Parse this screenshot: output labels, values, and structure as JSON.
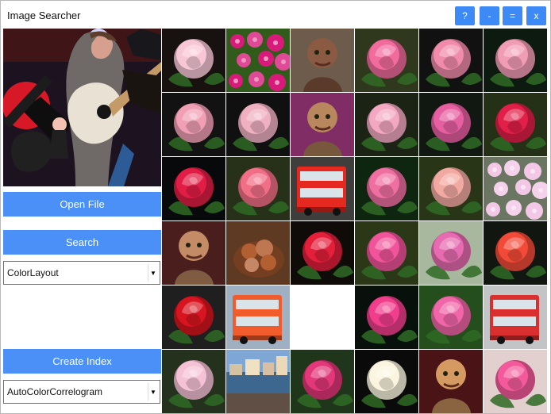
{
  "window": {
    "title": "Image Searcher"
  },
  "window_controls": [
    {
      "name": "help-button",
      "label": "?"
    },
    {
      "name": "minimize-button",
      "label": "-"
    },
    {
      "name": "maximize-button",
      "label": "="
    },
    {
      "name": "close-button",
      "label": "x"
    }
  ],
  "left_panel": {
    "open_file_label": "Open File",
    "search_label": "Search",
    "search_feature": "ColorLayout",
    "create_index_label": "Create Index",
    "index_feature": "AutoColorCorrelogram"
  },
  "results": [
    {
      "kind": "rose",
      "color": "#f7c7d6",
      "bg": "#17120f"
    },
    {
      "kind": "flowers",
      "color": "#d81b7a",
      "bg": "#315b1a"
    },
    {
      "kind": "portrait",
      "color": "#8a5a42",
      "bg": "#6d5b4b"
    },
    {
      "kind": "rose",
      "color": "#f16b9c",
      "bg": "#2f381d"
    },
    {
      "kind": "rose",
      "color": "#f08bab",
      "bg": "#111111"
    },
    {
      "kind": "rose",
      "color": "#f19cb5",
      "bg": "#0d1a10"
    },
    {
      "kind": "rose",
      "color": "#f09fb4",
      "bg": "#121212"
    },
    {
      "kind": "rose",
      "color": "#efb0c2",
      "bg": "#101010"
    },
    {
      "kind": "portrait",
      "color": "#b9875d",
      "bg": "#7f2d64"
    },
    {
      "kind": "rose",
      "color": "#f3a8c1",
      "bg": "#1b2414"
    },
    {
      "kind": "rose",
      "color": "#e65fa1",
      "bg": "#111711"
    },
    {
      "kind": "rose",
      "color": "#e21f48",
      "bg": "#243117"
    },
    {
      "kind": "rose",
      "color": "#e11d45",
      "bg": "#08090a"
    },
    {
      "kind": "rose",
      "color": "#f16f86",
      "bg": "#273019"
    },
    {
      "kind": "bus",
      "color": "#e52820",
      "bg": "#3e3f3c"
    },
    {
      "kind": "rose",
      "color": "#f06fa1",
      "bg": "#0e2510"
    },
    {
      "kind": "rose",
      "color": "#f2a9a2",
      "bg": "#283517"
    },
    {
      "kind": "flowers",
      "color": "#f3c7e6",
      "bg": "#6a7661"
    },
    {
      "kind": "portrait",
      "color": "#c48c66",
      "bg": "#4a1e1c"
    },
    {
      "kind": "food",
      "color": "#b25f31",
      "bg": "#5e3a22"
    },
    {
      "kind": "rose",
      "color": "#e31f3a",
      "bg": "#0e0b08"
    },
    {
      "kind": "rose",
      "color": "#f1549b",
      "bg": "#2b3818"
    },
    {
      "kind": "rose",
      "color": "#e66bb0",
      "bg": "#a7b89e"
    },
    {
      "kind": "rose",
      "color": "#f34a38",
      "bg": "#111611"
    },
    {
      "kind": "rose",
      "color": "#d7141f",
      "bg": "#1f1f1f"
    },
    {
      "kind": "bus",
      "color": "#f05c2c",
      "bg": "#9eb0c2"
    },
    {
      "kind": "blank",
      "color": "#ffffff",
      "bg": "#ffffff"
    },
    {
      "kind": "rose",
      "color": "#f03d8c",
      "bg": "#07100a"
    },
    {
      "kind": "rose",
      "color": "#f066a8",
      "bg": "#244e1b"
    },
    {
      "kind": "bus",
      "color": "#d92f2f",
      "bg": "#c2c4c6"
    },
    {
      "kind": "rose",
      "color": "#f5c1d5",
      "bg": "#24311c"
    },
    {
      "kind": "city",
      "color": "#6f98c9",
      "bg": "#9db7d1"
    },
    {
      "kind": "rose",
      "color": "#e23778",
      "bg": "#20361a"
    },
    {
      "kind": "rose",
      "color": "#fbf5df",
      "bg": "#0a0a0a"
    },
    {
      "kind": "portrait",
      "color": "#d59a62",
      "bg": "#4a1315"
    },
    {
      "kind": "rose",
      "color": "#f45a9b",
      "bg": "#e2d0cf"
    }
  ],
  "colors": {
    "accent": "#4a90f7",
    "control": "#3d8af7"
  }
}
